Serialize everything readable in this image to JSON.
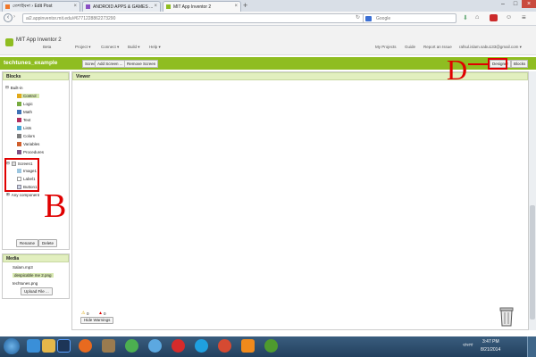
{
  "browser": {
    "tabs": [
      {
        "label": "তেশাইবনা › Edit Post",
        "active": false
      },
      {
        "label": "ANDROID APPS & GAMES ...",
        "active": false
      },
      {
        "label": "MIT App Inventor 2",
        "active": true
      }
    ],
    "url": "ai2.appinventor.mit.edu/#6771228862273290",
    "search_engine": "Google",
    "colors": {
      "accent": "#8fbd21",
      "annotation": "#e00000"
    }
  },
  "header": {
    "brand": "MIT App Inventor 2",
    "brand_sub": "Beta",
    "menus": [
      "Project ▾",
      "Connect ▾",
      "Build ▾",
      "Help ▾"
    ],
    "right_links": [
      "My Projects",
      "Guide",
      "Report an Issue",
      "rafsul.islam.sabu133@gmail.com ▾"
    ]
  },
  "project_bar": {
    "project_name": "techtunes_example",
    "screen_dropdown": "Screen1 ▾",
    "add_screen": "Add Screen ...",
    "remove_screen": "Remove Screen",
    "designer": "Designer",
    "blocks": "Blocks"
  },
  "blocks_panel": {
    "title": "Blocks",
    "builtin": {
      "label": "Built-in",
      "items": [
        {
          "label": "Control",
          "color": "#e1a91a"
        },
        {
          "label": "Logic",
          "color": "#77ab41"
        },
        {
          "label": "Math",
          "color": "#3f71b5"
        },
        {
          "label": "Text",
          "color": "#b32d5e"
        },
        {
          "label": "Lists",
          "color": "#49a6d4"
        },
        {
          "label": "Colors",
          "color": "#7d7d7d"
        },
        {
          "label": "Variables",
          "color": "#d05f2d"
        },
        {
          "label": "Procedures",
          "color": "#7c5385"
        }
      ]
    },
    "screen": {
      "label": "Screen1",
      "items": [
        "Image1",
        "Label1",
        "Button1"
      ]
    },
    "any_component": "Any component",
    "rename": "Rename",
    "delete": "Delete"
  },
  "media_panel": {
    "title": "Media",
    "files": [
      "Salam.mp3",
      "despicable me 2.png",
      "techtunes.png"
    ],
    "upload": "Upload File ..."
  },
  "viewer": {
    "title": "Viewer",
    "warning_count": "0",
    "error_count": "0",
    "hide_warnings": "Hide Warnings"
  },
  "annotations": {
    "b": "B",
    "d": "D"
  },
  "taskbar": {
    "time": "3:47 PM",
    "date": "8/21/2014",
    "lang": "বাংলা",
    "icons": [
      "start-icon",
      "ie-icon",
      "explorer-icon",
      "photoshop-icon",
      "firefox-icon",
      "app-icon",
      "chrome-icon",
      "safari-icon",
      "opera-icon",
      "skype-icon",
      "chrome2-icon",
      "vlc-icon",
      "utorrent-icon"
    ]
  }
}
